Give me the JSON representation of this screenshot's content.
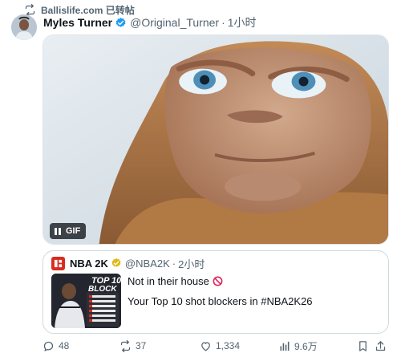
{
  "repost": {
    "text": "Ballislife.com 已转帖"
  },
  "tweet": {
    "author_name": "Myles Turner",
    "handle": "@Original_Turner",
    "separator": "·",
    "time": "1小时",
    "media": {
      "badge": "GIF"
    }
  },
  "quote": {
    "author_name": "NBA 2K",
    "handle": "@NBA2K",
    "separator": "·",
    "time": "2小时",
    "line1": "Not in their house",
    "line2": "Your Top 10 shot blockers in #NBA2K26",
    "thumb_title_top": "TOP 10",
    "thumb_title_bottom": "BLOCK"
  },
  "actions": {
    "replies": "48",
    "reposts": "37",
    "likes": "1,334",
    "views": "9.6万"
  },
  "colors": {
    "verified_blue": "#1d9bf0",
    "gold_badge": "#e2b719",
    "nba2k_red": "#d62d20",
    "muted_text": "#536471"
  }
}
